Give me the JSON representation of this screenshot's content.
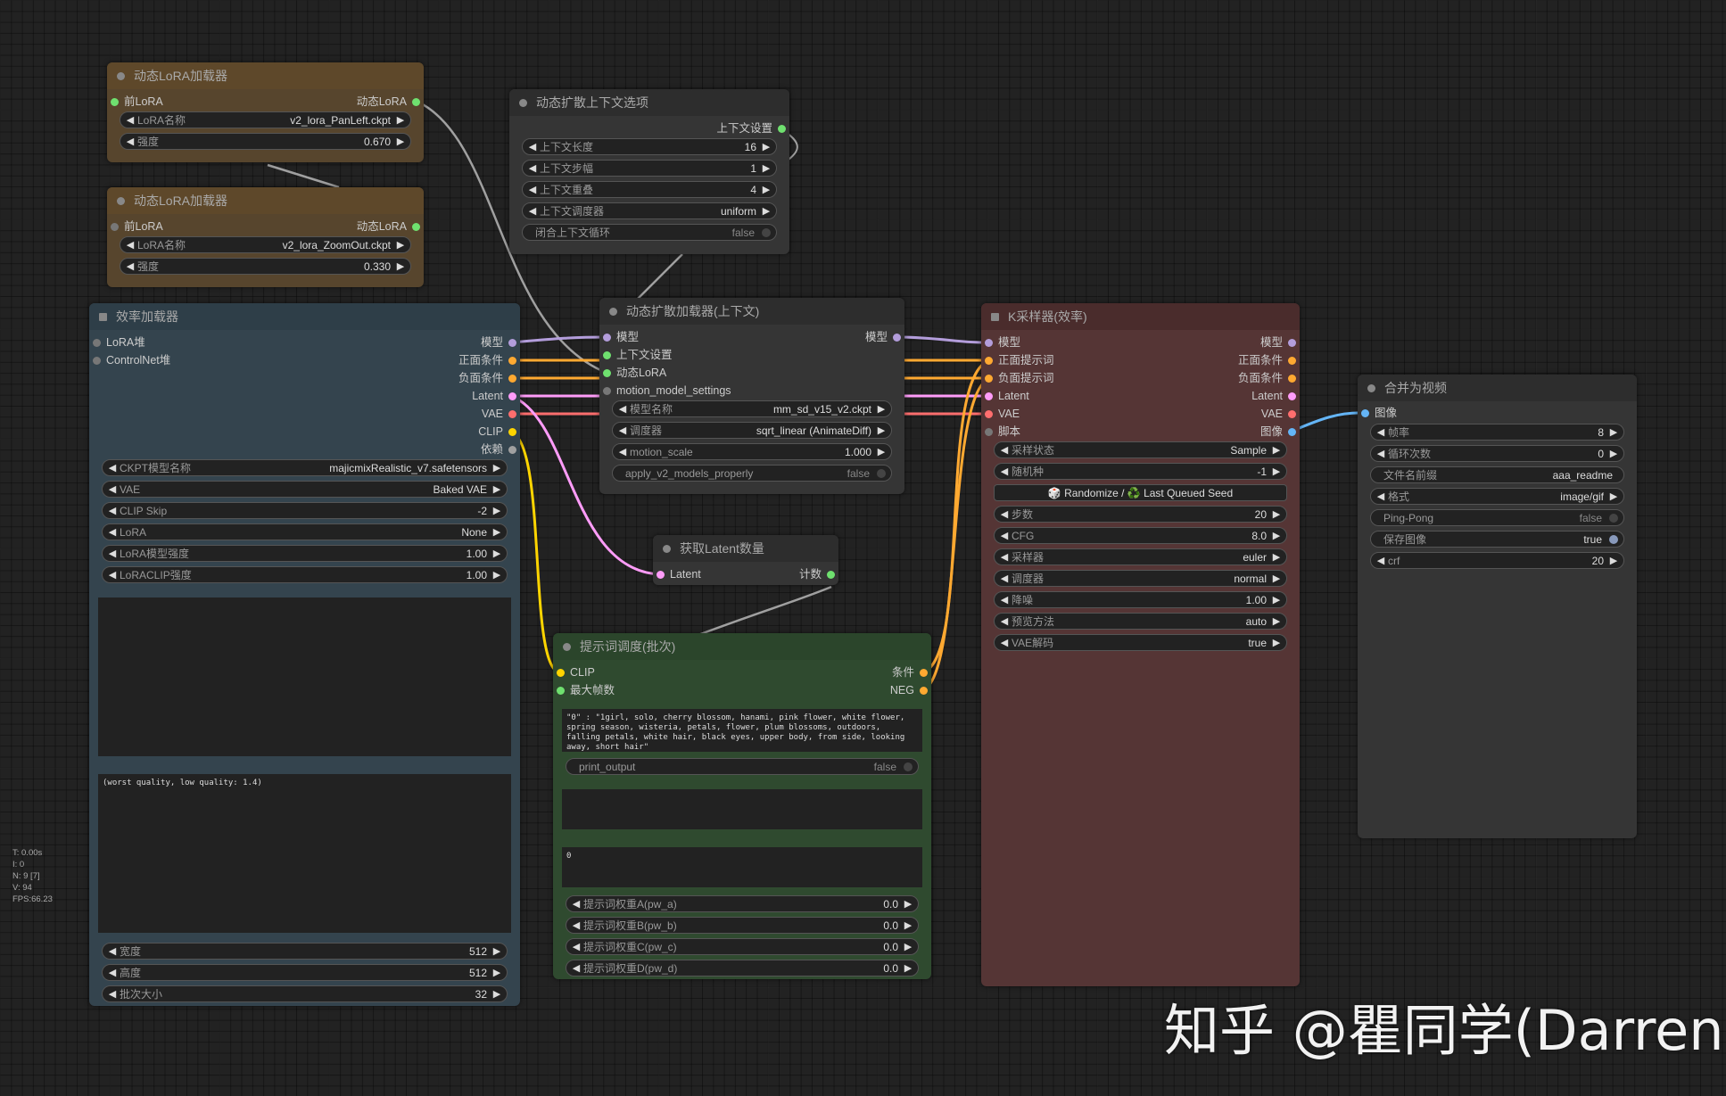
{
  "colors": {
    "background": "#222222",
    "model": "#b39ddb",
    "conditioning": "#ffa931",
    "latent": "#ff9cf9",
    "vae": "#ff6e6e",
    "clip": "#ffd500",
    "image": "#64b5f6",
    "int": "#6fe06f",
    "generic": "#a0a0a0"
  },
  "nodes": {
    "lora1": {
      "title": "动态LoRA加载器",
      "in_prev": "前LoRA",
      "out": "动态LoRA",
      "w_name_label": "LoRA名称",
      "w_name_value": "v2_lora_PanLeft.ckpt",
      "w_strength_label": "强度",
      "w_strength_value": "0.670"
    },
    "lora2": {
      "title": "动态LoRA加载器",
      "in_prev": "前LoRA",
      "out": "动态LoRA",
      "w_name_label": "LoRA名称",
      "w_name_value": "v2_lora_ZoomOut.ckpt",
      "w_strength_label": "强度",
      "w_strength_value": "0.330"
    },
    "context": {
      "title": "动态扩散上下文选项",
      "out": "上下文设置",
      "w1_label": "上下文长度",
      "w1_value": "16",
      "w2_label": "上下文步幅",
      "w2_value": "1",
      "w3_label": "上下文重叠",
      "w3_value": "4",
      "w4_label": "上下文调度器",
      "w4_value": "uniform",
      "w5_label": "闭合上下文循环",
      "w5_value": "false"
    },
    "efficient": {
      "title": "效率加载器",
      "in1": "LoRA堆",
      "in2": "ControlNet堆",
      "out1": "模型",
      "out2": "正面条件",
      "out3": "负面条件",
      "out4": "Latent",
      "out5": "VAE",
      "out6": "CLIP",
      "out7": "依赖",
      "w1_label": "CKPT模型名称",
      "w1_value": "majicmixRealistic_v7.safetensors",
      "w2_label": "VAE",
      "w2_value": "Baked VAE",
      "w3_label": "CLIP Skip",
      "w3_value": "-2",
      "w4_label": "LoRA",
      "w4_value": "None",
      "w5_label": "LoRA模型强度",
      "w5_value": "1.00",
      "w6_label": "LoRACLIP强度",
      "w6_value": "1.00",
      "negative_text": "(worst quality, low quality: 1.4)",
      "w7_label": "宽度",
      "w7_value": "512",
      "w8_label": "高度",
      "w8_value": "512",
      "w9_label": "批次大小",
      "w9_value": "32"
    },
    "animatediff": {
      "title": "动态扩散加载器(上下文)",
      "in1": "模型",
      "in2": "上下文设置",
      "in3": "动态LoRA",
      "in4": "motion_model_settings",
      "out1": "模型",
      "w1_label": "模型名称",
      "w1_value": "mm_sd_v15_v2.ckpt",
      "w2_label": "调度器",
      "w2_value": "sqrt_linear (AnimateDiff)",
      "w3_label": "motion_scale",
      "w3_value": "1.000",
      "w4_label": "apply_v2_models_properly",
      "w4_value": "false"
    },
    "latentcount": {
      "title": "获取Latent数量",
      "in1": "Latent",
      "out1": "计数"
    },
    "prompt": {
      "title": "提示词调度(批次)",
      "in1": "CLIP",
      "in2": "最大帧数",
      "out1": "条件",
      "out2": "NEG",
      "text": "\"0\" : \"1girl, solo, cherry blossom, hanami, pink flower, white flower, spring season, wisteria, petals, flower, plum blossoms, outdoors, falling petals, white hair, black eyes, upper body, from side, looking away, short hair\"",
      "print_label": "print_output",
      "print_value": "false",
      "text2": "0",
      "w1_label": "提示词权重A(pw_a)",
      "w1_value": "0.0",
      "w2_label": "提示词权重B(pw_b)",
      "w2_value": "0.0",
      "w3_label": "提示词权重C(pw_c)",
      "w3_value": "0.0",
      "w4_label": "提示词权重D(pw_d)",
      "w4_value": "0.0"
    },
    "ksampler": {
      "title": "K采样器(效率)",
      "in1": "模型",
      "in2": "正面提示词",
      "in3": "负面提示词",
      "in4": "Latent",
      "in5": "VAE",
      "in6": "脚本",
      "out1": "模型",
      "out2": "正面条件",
      "out3": "负面条件",
      "out4": "Latent",
      "out5": "VAE",
      "out6": "图像",
      "w1_label": "采样状态",
      "w1_value": "Sample",
      "w2_label": "随机种",
      "w2_value": "-1",
      "seed_button": "🎲 Randomize / ♻️ Last Queued Seed",
      "w3_label": "步数",
      "w3_value": "20",
      "w4_label": "CFG",
      "w4_value": "8.0",
      "w5_label": "采样器",
      "w5_value": "euler",
      "w6_label": "调度器",
      "w6_value": "normal",
      "w7_label": "降噪",
      "w7_value": "1.00",
      "w8_label": "预览方法",
      "w8_value": "auto",
      "w9_label": "VAE解码",
      "w9_value": "true"
    },
    "video": {
      "title": "合并为视频",
      "in1": "图像",
      "w1_label": "帧率",
      "w1_value": "8",
      "w2_label": "循环次数",
      "w2_value": "0",
      "w3_label": "文件名前缀",
      "w3_value": "aaa_readme",
      "w4_label": "格式",
      "w4_value": "image/gif",
      "w5_label": "Ping-Pong",
      "w5_value": "false",
      "w6_label": "保存图像",
      "w6_value": "true",
      "w7_label": "crf",
      "w7_value": "20"
    }
  },
  "stats": {
    "t": "T: 0.00s",
    "i": "I: 0",
    "n": "N: 9 [7]",
    "v": "V: 94",
    "fps": "FPS:66.23"
  },
  "watermark": "知乎 @瞿同学(Darren)"
}
